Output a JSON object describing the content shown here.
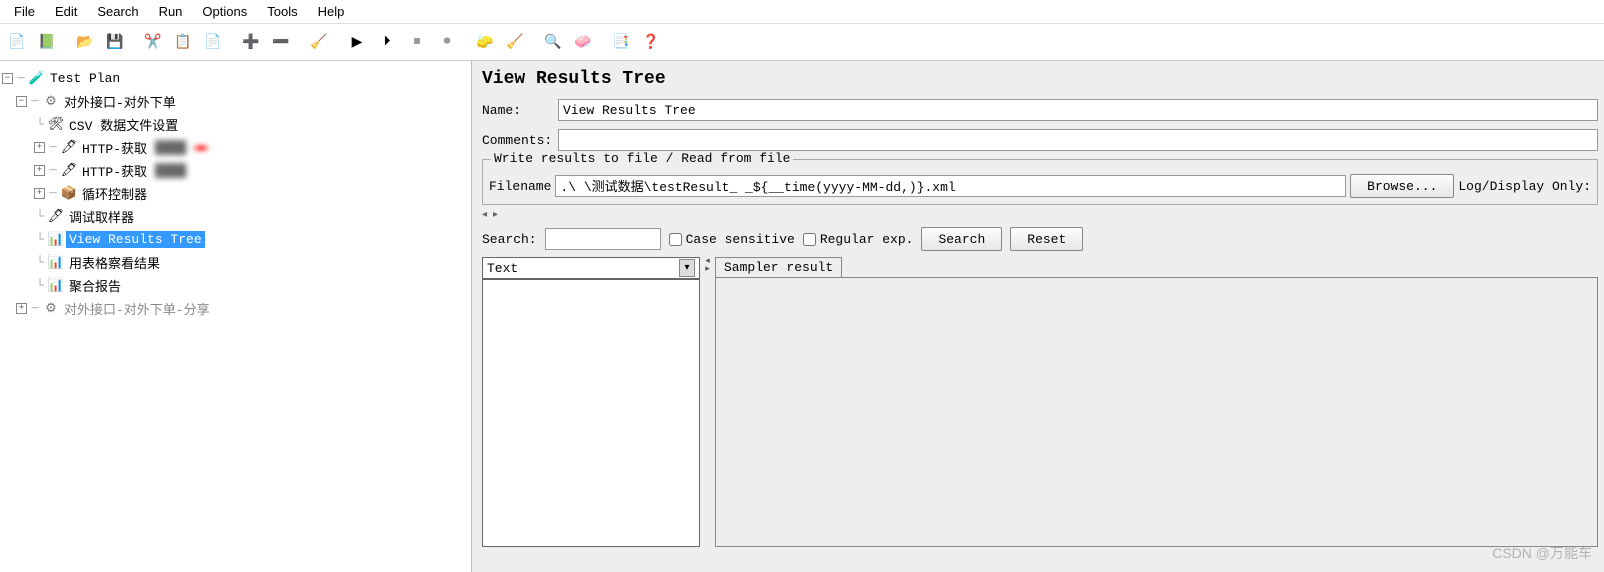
{
  "menu": [
    "File",
    "Edit",
    "Search",
    "Run",
    "Options",
    "Tools",
    "Help"
  ],
  "toolbar_icons": [
    {
      "name": "new-icon",
      "glyph": "📄"
    },
    {
      "name": "template-icon",
      "glyph": "📗"
    },
    {
      "sep": true
    },
    {
      "name": "open-icon",
      "glyph": "📂"
    },
    {
      "name": "save-icon",
      "glyph": "💾"
    },
    {
      "sep": true
    },
    {
      "name": "cut-icon",
      "glyph": "✂️"
    },
    {
      "name": "copy-icon",
      "glyph": "📋"
    },
    {
      "name": "paste-icon",
      "glyph": "📄"
    },
    {
      "sep": true
    },
    {
      "name": "add-icon",
      "glyph": "➕"
    },
    {
      "name": "remove-icon",
      "glyph": "➖"
    },
    {
      "sep": true
    },
    {
      "name": "clear-icon",
      "glyph": "🧹"
    },
    {
      "sep": true
    },
    {
      "name": "start-icon",
      "glyph": "▶"
    },
    {
      "name": "start-notimers-icon",
      "glyph": "⏵"
    },
    {
      "name": "stop-icon",
      "glyph": "⏹",
      "disabled": true
    },
    {
      "name": "shutdown-icon",
      "glyph": "⏺",
      "disabled": true
    },
    {
      "sep": true
    },
    {
      "name": "clear1-icon",
      "glyph": "🧽"
    },
    {
      "name": "clear2-icon",
      "glyph": "🧹"
    },
    {
      "sep": true
    },
    {
      "name": "search-icon",
      "glyph": "🔍"
    },
    {
      "name": "reset-search-icon",
      "glyph": "🧼"
    },
    {
      "sep": true
    },
    {
      "name": "fn1-icon",
      "glyph": "📑"
    },
    {
      "name": "help-icon",
      "glyph": "❓"
    }
  ],
  "tree": {
    "root": "Test Plan",
    "group1": "对外接口-对外下单",
    "csv": "CSV 数据文件设置",
    "http1": "HTTP-获取",
    "http2": "HTTP-获取",
    "loop": "循环控制器",
    "debug": "调试取样器",
    "results": "View Results Tree",
    "table": "用表格察看结果",
    "aggregate": "聚合报告",
    "group2": "对外接口-对外下单-分享"
  },
  "panel": {
    "title": "View Results Tree",
    "name_label": "Name:",
    "name_value": "View Results Tree",
    "comments_label": "Comments:",
    "comments_value": "",
    "fieldset_legend": "Write results to file / Read from file",
    "filename_label": "Filename",
    "filename_value": ".\\                                    \\测试数据\\testResult_         _${__time(yyyy-MM-dd,)}.xml",
    "browse_button": "Browse...",
    "log_display": "Log/Display Only:",
    "search_label": "Search:",
    "chk_case": "Case sensitive",
    "chk_regex": "Regular exp.",
    "search_button": "Search",
    "reset_button": "Reset",
    "combo_value": "Text",
    "tab_sampler": "Sampler result"
  },
  "watermark": "CSDN @万能车"
}
